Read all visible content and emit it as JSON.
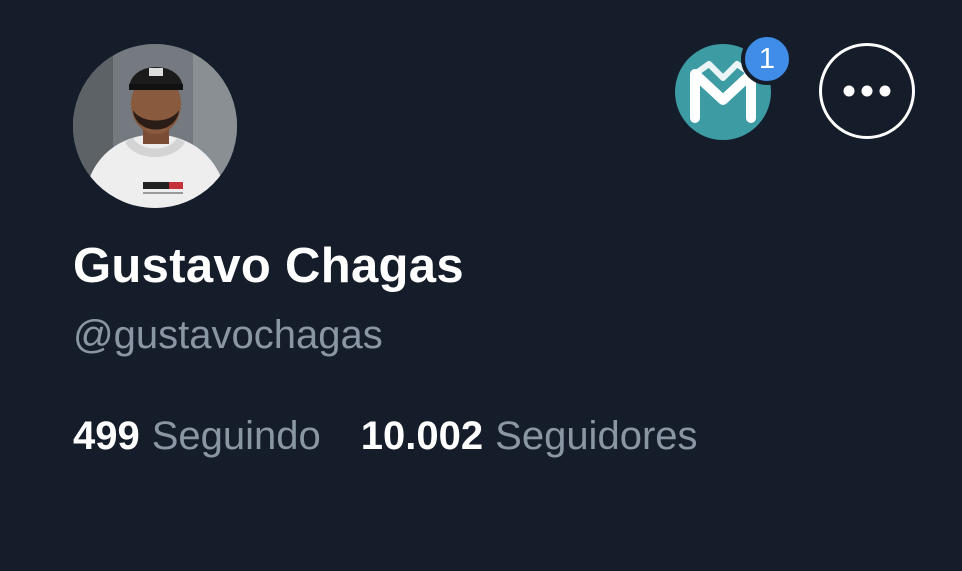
{
  "profile": {
    "name": "Gustavo Chagas",
    "handle": "@gustavochagas",
    "avatar": "profile-photo"
  },
  "app_icon": {
    "name": "m-logo-icon",
    "color": "#3c9ba3",
    "badge_count": "1",
    "badge_color": "#3f8de6"
  },
  "more_button": {
    "icon": "more-horizontal-icon"
  },
  "stats": {
    "following_count": "499",
    "following_label": "Seguindo",
    "followers_count": "10.002",
    "followers_label": "Seguidores"
  },
  "colors": {
    "background": "#161d2a",
    "text_primary": "#ffffff",
    "text_secondary": "#8a96a3"
  }
}
